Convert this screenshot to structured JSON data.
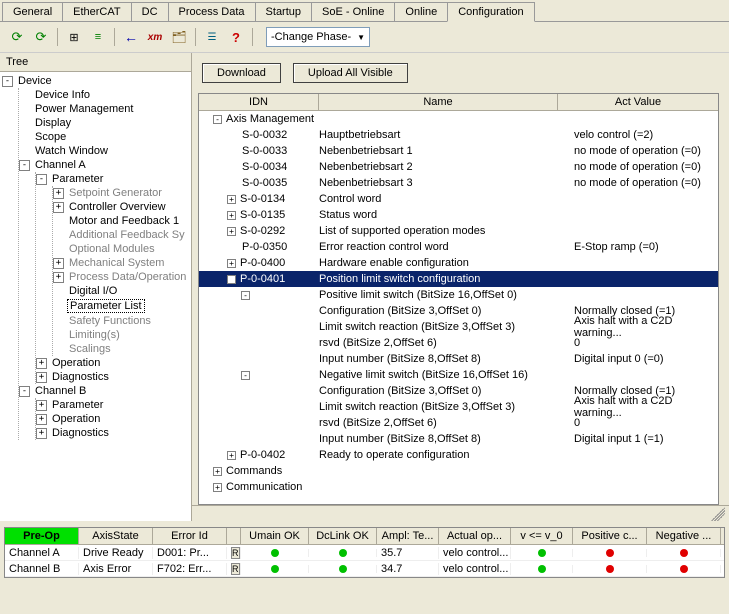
{
  "tabs": [
    "General",
    "EtherCAT",
    "DC",
    "Process Data",
    "Startup",
    "SoE - Online",
    "Online",
    "Configuration"
  ],
  "activeTab": "Configuration",
  "toolbar": {
    "phase": "-Change Phase-"
  },
  "treeHeader": "Tree",
  "tree": {
    "root": "Device",
    "deviceChildren": [
      "Device Info",
      "Power Management",
      "Display",
      "Scope",
      "Watch Window"
    ],
    "channelA": "Channel A",
    "parameter": "Parameter",
    "paramChildren": [
      {
        "label": "Setpoint Generator",
        "dim": true,
        "exp": true
      },
      {
        "label": "Controller Overview",
        "dim": false,
        "exp": true
      },
      {
        "label": "Motor and Feedback 1",
        "dim": false,
        "exp": false
      },
      {
        "label": "Additional Feedback Sy",
        "dim": true,
        "exp": false
      },
      {
        "label": "Optional Modules",
        "dim": true,
        "exp": false
      },
      {
        "label": "Mechanical System",
        "dim": true,
        "exp": true
      },
      {
        "label": "Process Data/Operation",
        "dim": true,
        "exp": true
      },
      {
        "label": "Digital I/O",
        "dim": false,
        "exp": false
      },
      {
        "label": "Parameter List",
        "dim": false,
        "exp": false,
        "selected": true
      },
      {
        "label": "Safety Functions",
        "dim": true,
        "exp": false
      },
      {
        "label": "Limiting(s)",
        "dim": true,
        "exp": false
      },
      {
        "label": "Scalings",
        "dim": true,
        "exp": false
      }
    ],
    "operation": "Operation",
    "diagnostics": "Diagnostics",
    "channelB": "Channel B",
    "chBChildren": [
      "Parameter",
      "Operation",
      "Diagnostics"
    ]
  },
  "rightButtons": {
    "download": "Download",
    "upload": "Upload All Visible"
  },
  "gridHeaders": [
    "IDN",
    "Name",
    "Act Value"
  ],
  "gridRows": [
    {
      "ind": 1,
      "exp": "-",
      "idn": "Axis Management",
      "name": "",
      "val": ""
    },
    {
      "ind": 2,
      "exp": "",
      "idn": "S-0-0032",
      "name": "Hauptbetriebsart",
      "val": "velo control (=2)"
    },
    {
      "ind": 2,
      "exp": "",
      "idn": "S-0-0033",
      "name": "Nebenbetriebsart 1",
      "val": "no mode of operation (=0)"
    },
    {
      "ind": 2,
      "exp": "",
      "idn": "S-0-0034",
      "name": "Nebenbetriebsart 2",
      "val": "no mode of operation (=0)"
    },
    {
      "ind": 2,
      "exp": "",
      "idn": "S-0-0035",
      "name": "Nebenbetriebsart 3",
      "val": "no mode of operation (=0)"
    },
    {
      "ind": 2,
      "exp": "+",
      "idn": "S-0-0134",
      "name": "Control word",
      "val": ""
    },
    {
      "ind": 2,
      "exp": "+",
      "idn": "S-0-0135",
      "name": "Status word",
      "val": ""
    },
    {
      "ind": 2,
      "exp": "+",
      "idn": "S-0-0292",
      "name": "List of supported operation modes",
      "val": ""
    },
    {
      "ind": 2,
      "exp": "",
      "idn": "P-0-0350",
      "name": "Error reaction control word",
      "val": "E-Stop ramp (=0)"
    },
    {
      "ind": 2,
      "exp": "+",
      "idn": "P-0-0400",
      "name": "Hardware enable configuration",
      "val": ""
    },
    {
      "ind": 2,
      "exp": "-",
      "idn": "P-0-0401",
      "name": "Position limit switch configuration",
      "val": "",
      "selected": true
    },
    {
      "ind": 3,
      "exp": "-",
      "idn": "",
      "name": "Positive limit switch (BitSize 16,OffSet 0)",
      "val": ""
    },
    {
      "ind": 4,
      "exp": "",
      "idn": "",
      "name": "Configuration (BitSize 3,OffSet 0)",
      "val": "Normally closed (=1)"
    },
    {
      "ind": 4,
      "exp": "",
      "idn": "",
      "name": "Limit switch reaction (BitSize 3,OffSet 3)",
      "val": "Axis halt with a C2D warning..."
    },
    {
      "ind": 4,
      "exp": "",
      "idn": "",
      "name": "rsvd (BitSize 2,OffSet 6)",
      "val": "0"
    },
    {
      "ind": 4,
      "exp": "",
      "idn": "",
      "name": "Input number (BitSize 8,OffSet 8)",
      "val": "Digital input 0 (=0)"
    },
    {
      "ind": 3,
      "exp": "-",
      "idn": "",
      "name": "Negative limit switch (BitSize 16,OffSet 16)",
      "val": ""
    },
    {
      "ind": 4,
      "exp": "",
      "idn": "",
      "name": "Configuration (BitSize 3,OffSet 0)",
      "val": "Normally closed (=1)"
    },
    {
      "ind": 4,
      "exp": "",
      "idn": "",
      "name": "Limit switch reaction (BitSize 3,OffSet 3)",
      "val": "Axis halt with a C2D warning..."
    },
    {
      "ind": 4,
      "exp": "",
      "idn": "",
      "name": "rsvd (BitSize 2,OffSet 6)",
      "val": "0"
    },
    {
      "ind": 4,
      "exp": "",
      "idn": "",
      "name": "Input number (BitSize 8,OffSet 8)",
      "val": "Digital input 1 (=1)"
    },
    {
      "ind": 2,
      "exp": "+",
      "idn": "P-0-0402",
      "name": "Ready to operate configuration",
      "val": ""
    },
    {
      "ind": 1,
      "exp": "+",
      "idn": "Commands",
      "name": "",
      "val": ""
    },
    {
      "ind": 1,
      "exp": "+",
      "idn": "Communication",
      "name": "",
      "val": ""
    }
  ],
  "statusHeaders": [
    "Pre-Op",
    "AxisState",
    "Error Id",
    "",
    "Umain OK",
    "DcLink OK",
    "Ampl: Te...",
    "Actual op...",
    "v <= v_0",
    "Positive c...",
    "Negative ..."
  ],
  "statusRows": [
    {
      "ch": "Channel A",
      "state": "Drive Ready",
      "err": "D001: Pr...",
      "umain": "g",
      "dclink": "g",
      "ampl": "35.7",
      "op": "velo control...",
      "v0": "g",
      "pos": "r",
      "neg": "r"
    },
    {
      "ch": "Channel B",
      "state": "Axis Error",
      "err": "F702: Err...",
      "umain": "g",
      "dclink": "g",
      "ampl": "34.7",
      "op": "velo control...",
      "v0": "g",
      "pos": "r",
      "neg": "r"
    }
  ]
}
